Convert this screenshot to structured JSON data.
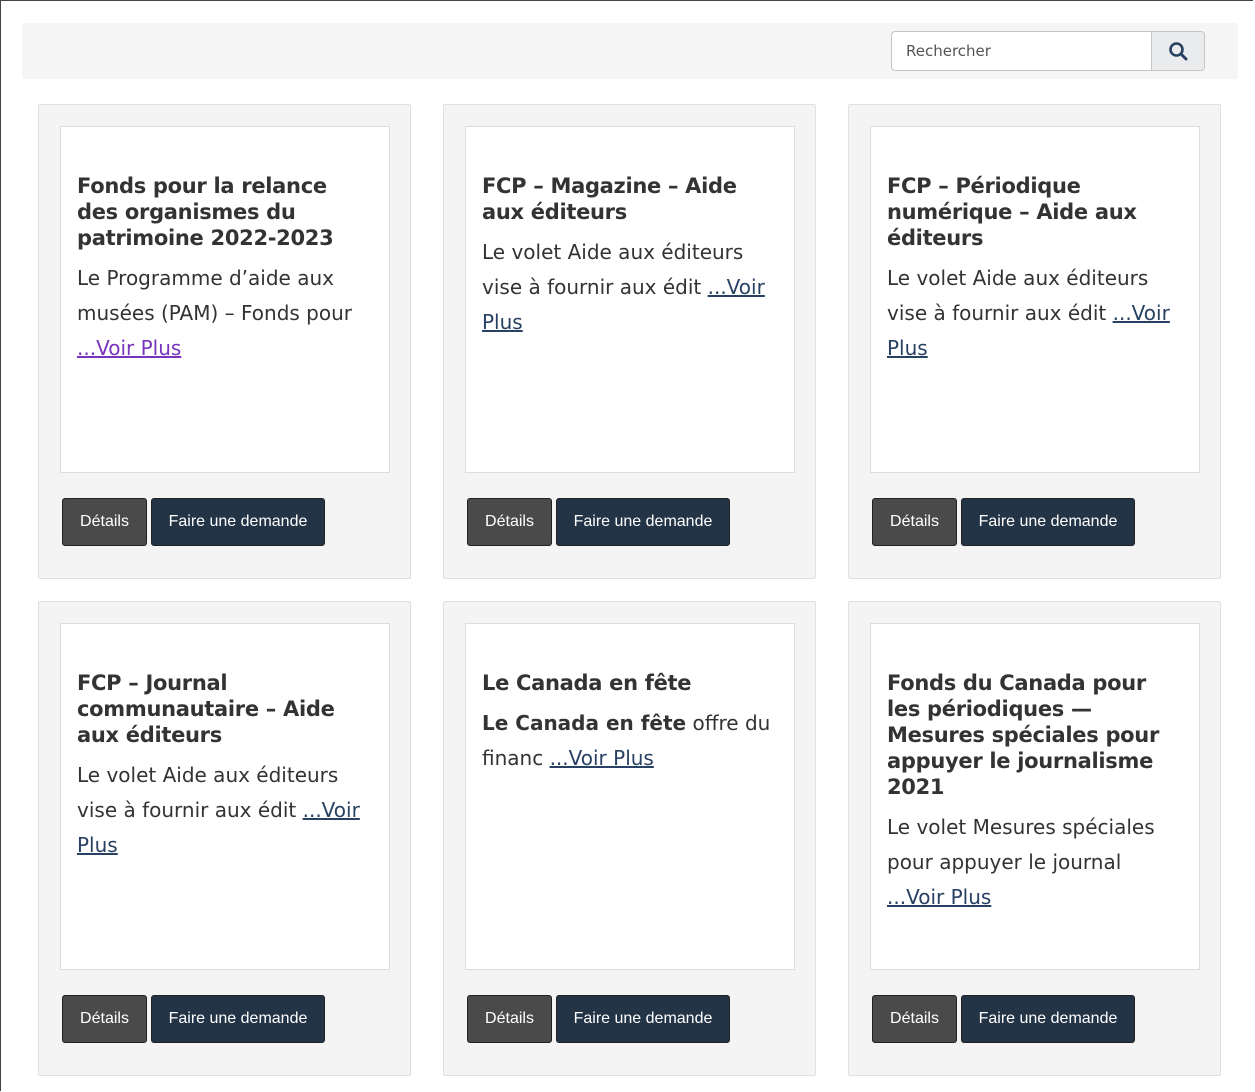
{
  "search": {
    "placeholder": "Rechercher",
    "button_icon": "search-icon"
  },
  "cards": [
    {
      "title": "Fonds pour la relance des organismes du patrimoine 2022-2023",
      "desc_bold": "",
      "desc": "Le Programme d’aide aux musées (PAM) – Fonds pour ",
      "link": "...Voir Plus",
      "visited": true,
      "details_label": "Détails",
      "apply_label": "Faire une demande"
    },
    {
      "title": "FCP – Magazine – Aide aux éditeurs",
      "desc_bold": "",
      "desc": "Le volet Aide aux éditeurs vise à fournir aux édit ",
      "link": "...Voir Plus",
      "visited": false,
      "details_label": "Détails",
      "apply_label": "Faire une demande"
    },
    {
      "title": "FCP – Périodique numérique – Aide aux éditeurs",
      "desc_bold": "",
      "desc": "Le volet Aide aux éditeurs vise à fournir aux édit ",
      "link": "...Voir Plus",
      "visited": false,
      "details_label": "Détails",
      "apply_label": "Faire une demande"
    },
    {
      "title": "FCP – Journal communautaire – Aide aux éditeurs",
      "desc_bold": "",
      "desc": "Le volet Aide aux éditeurs vise à fournir aux édit ",
      "link": "...Voir Plus",
      "visited": false,
      "details_label": "Détails",
      "apply_label": "Faire une demande"
    },
    {
      "title": "Le Canada en fête",
      "desc_bold": "Le Canada en fête",
      "desc": " offre du financ ",
      "link": "...Voir Plus",
      "visited": false,
      "details_label": "Détails",
      "apply_label": "Faire une demande"
    },
    {
      "title": "Fonds du Canada pour les périodiques — Mesures spéciales pour appuyer le journalisme 2021",
      "desc_bold": "",
      "desc": "Le volet Mesures spéciales pour appuyer le journal ",
      "link": "...Voir Plus",
      "visited": false,
      "details_label": "Détails",
      "apply_label": "Faire une demande"
    }
  ],
  "colors": {
    "link": "#284162",
    "link_visited": "#7834bc",
    "details_button": "#4a4a4a",
    "apply_button": "#243447"
  }
}
